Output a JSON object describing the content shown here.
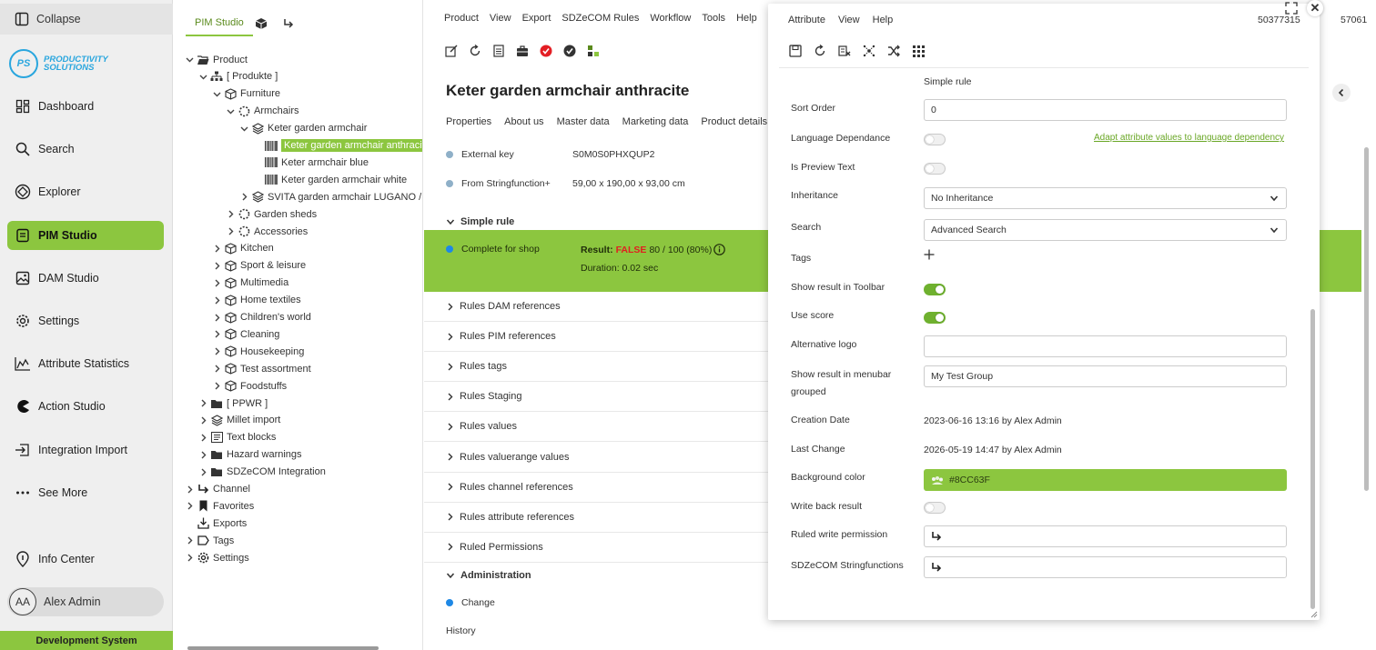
{
  "sidebar": {
    "collapse_label": "Collapse",
    "logo_text_line1": "PRODUCTIVITY",
    "logo_text_line2": "SOLUTIONS",
    "logo_mark": "PS",
    "items": [
      {
        "label": "Dashboard",
        "icon": "dashboard-icon"
      },
      {
        "label": "Search",
        "icon": "search-icon"
      },
      {
        "label": "Explorer",
        "icon": "explorer-icon"
      },
      {
        "label": "PIM Studio",
        "icon": "pim-studio-icon",
        "active": true
      },
      {
        "label": "DAM Studio",
        "icon": "image-icon"
      },
      {
        "label": "Settings",
        "icon": "gear-icon"
      },
      {
        "label": "Attribute Statistics",
        "icon": "chart-icon"
      },
      {
        "label": "Action Studio",
        "icon": "pacman-icon"
      },
      {
        "label": "Integration Import",
        "icon": "import-icon"
      },
      {
        "label": "See More",
        "icon": "more-icon"
      }
    ],
    "info_center": "Info Center",
    "user_initials": "AA",
    "user_name": "Alex Admin",
    "environment": "Development System",
    "accent_color": "#8cc63f"
  },
  "tree": {
    "tabs": [
      "PIM Studio"
    ],
    "nodes": [
      {
        "label": "Product",
        "level": 0,
        "expanded": true,
        "icon": "folder-open-icon"
      },
      {
        "label": "[ Produkte ]",
        "level": 1,
        "expanded": true,
        "icon": "hierarchy-icon"
      },
      {
        "label": "Furniture",
        "level": 2,
        "expanded": true,
        "icon": "box-icon"
      },
      {
        "label": "Armchairs",
        "level": 3,
        "expanded": true,
        "icon": "dotted-circle-icon"
      },
      {
        "label": "Keter garden armchair",
        "level": 4,
        "expanded": true,
        "icon": "layers-icon"
      },
      {
        "label": "Keter garden armchair anthracite",
        "level": 5,
        "icon": "barcode-icon",
        "selected": true
      },
      {
        "label": "Keter armchair blue",
        "level": 5,
        "icon": "barcode-icon"
      },
      {
        "label": "Keter garden armchair white",
        "level": 5,
        "icon": "barcode-icon"
      },
      {
        "label": "SVITA garden armchair LUGANO / CA",
        "level": 4,
        "expanded": false,
        "icon": "layers-icon"
      },
      {
        "label": "Garden sheds",
        "level": 3,
        "expanded": false,
        "icon": "dotted-circle-icon"
      },
      {
        "label": "Accessories",
        "level": 3,
        "expanded": false,
        "icon": "dotted-circle-icon"
      },
      {
        "label": "Kitchen",
        "level": 2,
        "expanded": false,
        "icon": "box-icon"
      },
      {
        "label": "Sport & leisure",
        "level": 2,
        "expanded": false,
        "icon": "box-icon"
      },
      {
        "label": "Multimedia",
        "level": 2,
        "expanded": false,
        "icon": "box-icon"
      },
      {
        "label": "Home textiles",
        "level": 2,
        "expanded": false,
        "icon": "box-icon"
      },
      {
        "label": "Children's world",
        "level": 2,
        "expanded": false,
        "icon": "box-icon"
      },
      {
        "label": "Cleaning",
        "level": 2,
        "expanded": false,
        "icon": "box-icon"
      },
      {
        "label": "Housekeeping",
        "level": 2,
        "expanded": false,
        "icon": "box-icon"
      },
      {
        "label": "Test assortment",
        "level": 2,
        "expanded": false,
        "icon": "box-icon"
      },
      {
        "label": "Foodstuffs",
        "level": 2,
        "expanded": false,
        "icon": "box-icon"
      },
      {
        "label": "[ PPWR ]",
        "level": 1,
        "expanded": false,
        "icon": "folder-icon"
      },
      {
        "label": "Millet import",
        "level": 1,
        "expanded": false,
        "icon": "layers-icon"
      },
      {
        "label": "Text blocks",
        "level": 1,
        "expanded": false,
        "icon": "textblock-icon"
      },
      {
        "label": "Hazard warnings",
        "level": 1,
        "expanded": false,
        "icon": "folder-icon"
      },
      {
        "label": "SDZeCOM Integration",
        "level": 1,
        "expanded": false,
        "icon": "folder-icon"
      },
      {
        "label": "Channel",
        "level": 0,
        "expanded": false,
        "icon": "channel-icon"
      },
      {
        "label": "Favorites",
        "level": 0,
        "expanded": false,
        "icon": "bookmark-icon"
      },
      {
        "label": "Exports",
        "level": 0,
        "icon": "export-icon"
      },
      {
        "label": "Tags",
        "level": 0,
        "expanded": false,
        "icon": "tag-icon"
      },
      {
        "label": "Settings",
        "level": 0,
        "expanded": false,
        "icon": "gear-icon"
      }
    ]
  },
  "main": {
    "menu": [
      "Product",
      "View",
      "Export",
      "SDZeCOM Rules",
      "Workflow",
      "Tools",
      "Help"
    ],
    "title": "Keter garden armchair anthracite",
    "tabs": [
      "Properties",
      "About us",
      "Master data",
      "Marketing data",
      "Product details"
    ],
    "fields": [
      {
        "key": "External key",
        "value": "S0M0S0PHXQUP2"
      },
      {
        "key": "From Stringfunction+",
        "value": "59,00 x 190,00 x 93,00 cm"
      }
    ],
    "simple_rule_section": "Simple rule",
    "rule": {
      "name": "Complete for shop",
      "result_prefix": "Result:",
      "result_flag": "FALSE",
      "result_score": "80 / 100 (80%)",
      "duration": "Duration: 0.02 sec"
    },
    "collapsed_sections": [
      "Rules DAM references",
      "Rules PIM references",
      "Rules tags",
      "Rules Staging",
      "Rules values",
      "Rules valuerange values",
      "Rules channel references",
      "Rules attribute references",
      "Ruled Permissions"
    ],
    "admin_section": "Administration",
    "change_label": "Change",
    "history_label": "History",
    "right_id": "57061"
  },
  "dialog": {
    "menu": [
      "Attribute",
      "View",
      "Help"
    ],
    "id": "50377315",
    "section_label": "Simple rule",
    "sort_order_label": "Sort Order",
    "sort_order_value": "0",
    "language_dependance_label": "Language Dependance",
    "language_dependance_on": false,
    "adapt_link": "Adapt attribute values to language dependency",
    "is_preview_text_label": "Is Preview Text",
    "is_preview_text_on": false,
    "inheritance_label": "Inheritance",
    "inheritance_value": "No Inheritance",
    "search_label": "Search",
    "search_value": "Advanced Search",
    "tags_label": "Tags",
    "show_result_toolbar_label": "Show result in Toolbar",
    "show_result_toolbar_on": true,
    "use_score_label": "Use score",
    "use_score_on": true,
    "alternative_logo_label": "Alternative logo",
    "alternative_logo_value": "",
    "show_result_menubar_label_1": "Show result in menubar",
    "show_result_menubar_label_2": "grouped",
    "show_result_menubar_value": "My Test Group",
    "creation_date_label": "Creation Date",
    "creation_date_value": "2023-06-16 13:16 by Alex Admin",
    "last_change_label": "Last Change",
    "last_change_value": "2026-05-19 14:47 by Alex Admin",
    "background_color_label": "Background color",
    "background_color_value": "#8CC63F",
    "write_back_result_label": "Write back result",
    "write_back_result_on": false,
    "ruled_write_permission_label": "Ruled write permission",
    "sdzecom_stringfunctions_label": "SDZeCOM Stringfunctions"
  }
}
